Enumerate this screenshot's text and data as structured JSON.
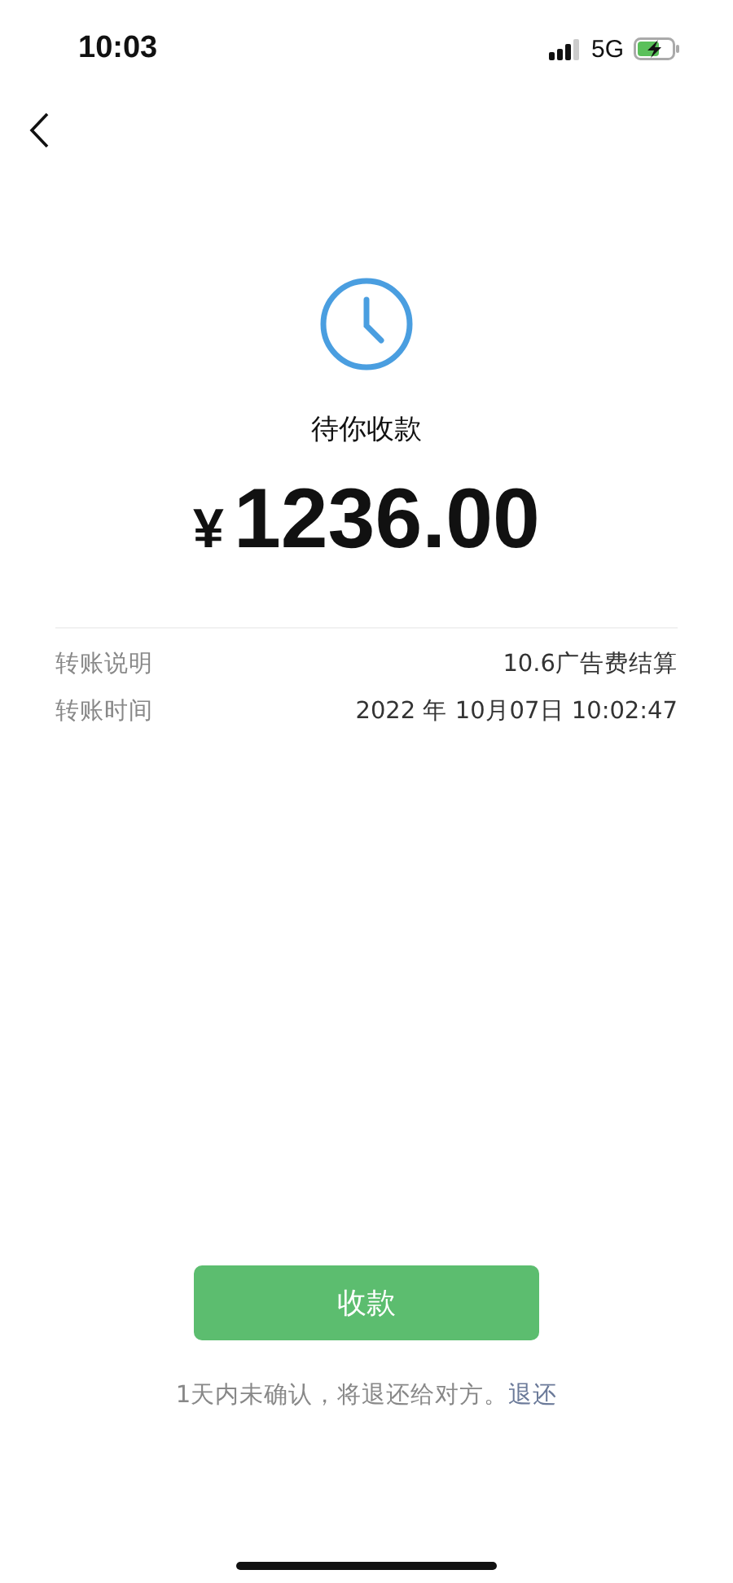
{
  "status_bar": {
    "time": "10:03",
    "network": "5G"
  },
  "status": {
    "title": "待你收款",
    "currency": "¥",
    "amount": "1236.00"
  },
  "details": [
    {
      "label": "转账说明",
      "value": "10.6广告费结算"
    },
    {
      "label": "转账时间",
      "value": "2022 年 10月07日 10:02:47"
    }
  ],
  "accept_button": "收款",
  "note": {
    "text": "1天内未确认，将退还给对方。",
    "link": "退还"
  }
}
